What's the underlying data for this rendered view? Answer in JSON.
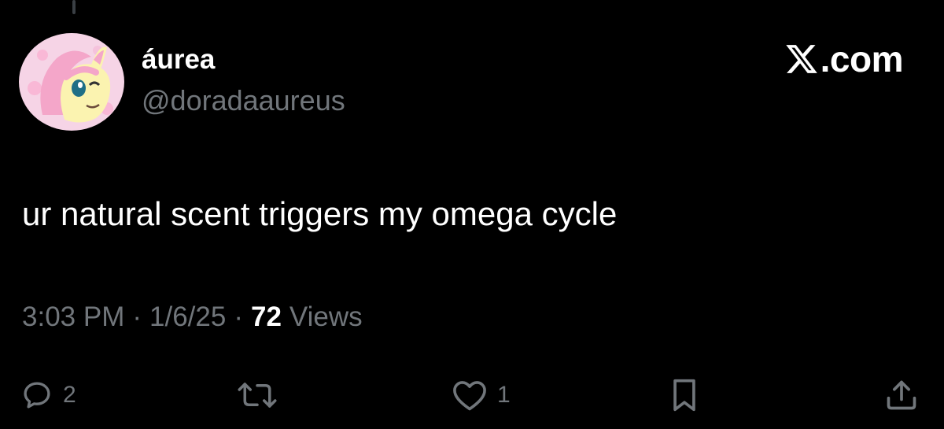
{
  "post": {
    "author": {
      "display_name": "áurea",
      "handle": "@doradaaureus",
      "avatar_icon": "pony-avatar"
    },
    "brand": {
      "text": ".com",
      "icon": "x-logo-icon"
    },
    "text": "ur natural scent triggers my omega cycle",
    "meta": {
      "time": "3:03 PM",
      "separator": "·",
      "date": "1/6/25",
      "views_count": "72",
      "views_label": "Views"
    },
    "actions": {
      "reply_count": "2",
      "like_count": "1"
    }
  },
  "colors": {
    "background": "#000000",
    "primary_text": "#ffffff",
    "secondary_text": "#71767b"
  }
}
